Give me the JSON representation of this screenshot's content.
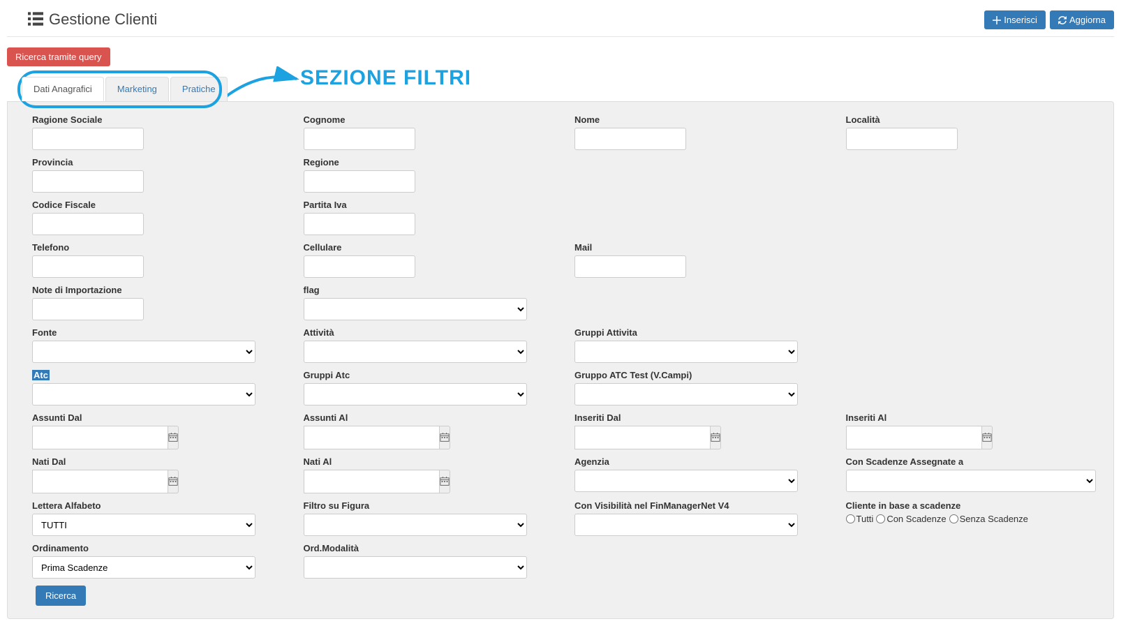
{
  "header": {
    "title": "Gestione Clienti",
    "insert_label": "Inserisci",
    "refresh_label": "Aggiorna"
  },
  "query_button": "Ricerca tramite query",
  "callout": "SEZIONE FILTRI",
  "tabs": {
    "anagrafici": "Dati Anagrafici",
    "marketing": "Marketing",
    "pratiche": "Pratiche"
  },
  "form": {
    "ragione_sociale": "Ragione Sociale",
    "cognome": "Cognome",
    "nome": "Nome",
    "localita": "Località",
    "provincia": "Provincia",
    "regione": "Regione",
    "codice_fiscale": "Codice Fiscale",
    "partita_iva": "Partita Iva",
    "telefono": "Telefono",
    "cellulare": "Cellulare",
    "mail": "Mail",
    "note_importazione": "Note di Importazione",
    "flag": "flag",
    "fonte": "Fonte",
    "attivita": "Attività",
    "gruppi_attivita": "Gruppi Attivita",
    "atc": "Atc",
    "gruppi_atc": "Gruppi Atc",
    "gruppo_atc_test": "Gruppo ATC Test (V.Campi)",
    "assunti_dal": "Assunti Dal",
    "assunti_al": "Assunti Al",
    "inseriti_dal": "Inseriti Dal",
    "inseriti_al": "Inseriti Al",
    "nati_dal": "Nati Dal",
    "nati_al": "Nati Al",
    "agenzia": "Agenzia",
    "con_scadenze_assegnate": "Con Scadenze Assegnate a",
    "lettera_alfabeto": "Lettera Alfabeto",
    "lettera_alfabeto_value": "TUTTI",
    "filtro_su_figura": "Filtro su Figura",
    "con_visibilita": "Con Visibilità nel FinManagerNet V4",
    "cliente_scadenze": "Cliente in base a scadenze",
    "radio_tutti": "Tutti",
    "radio_con": "Con Scadenze",
    "radio_senza": "Senza Scadenze",
    "ordinamento": "Ordinamento",
    "ordinamento_value": "Prima Scadenze",
    "ord_modalita": "Ord.Modalità"
  },
  "search_button": "Ricerca"
}
